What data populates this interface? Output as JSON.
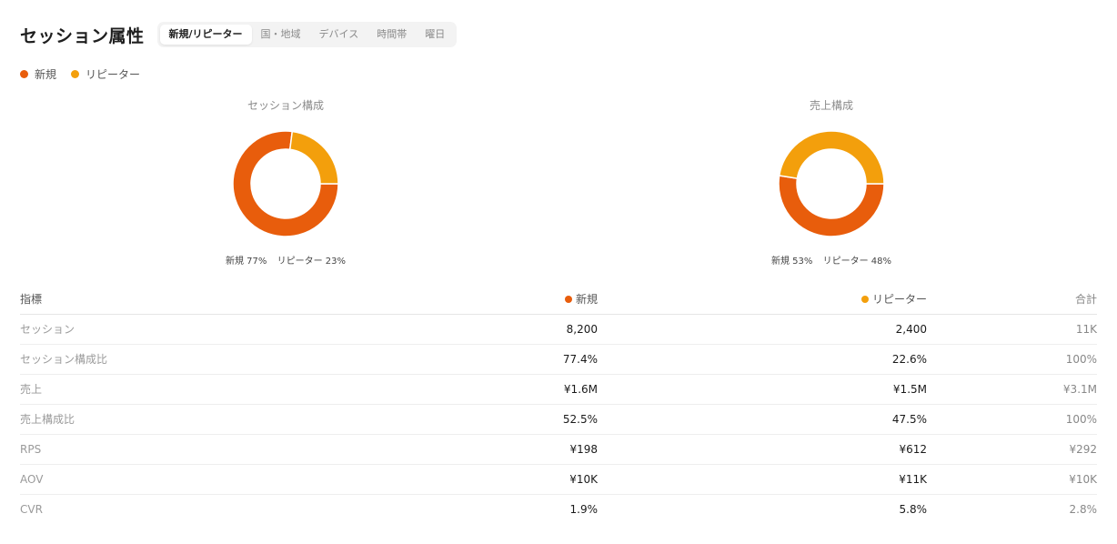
{
  "header": {
    "title": "セッション属性",
    "tabs": [
      "新規/リピーター",
      "国・地域",
      "デバイス",
      "時間帯",
      "曜日"
    ],
    "active_tab": "新規/リピーター"
  },
  "legend": [
    {
      "label": "新規",
      "color": "#e85d0c"
    },
    {
      "label": "リピーター",
      "color": "#f39f0c"
    }
  ],
  "colors": {
    "new": "#e85d0c",
    "repeat": "#f39f0c"
  },
  "chart_data": [
    {
      "type": "pie",
      "title": "セッション構成",
      "labels": [
        "新規",
        "リピーター"
      ],
      "values": [
        77,
        23
      ],
      "caption_new": "新規 77%",
      "caption_repeat": "リピーター 23%"
    },
    {
      "type": "pie",
      "title": "売上構成",
      "labels": [
        "新規",
        "リピーター"
      ],
      "values": [
        53,
        48
      ],
      "caption_new": "新規 53%",
      "caption_repeat": "リピーター 48%"
    }
  ],
  "table": {
    "headers": {
      "metric": "指標",
      "new": "新規",
      "repeat": "リピーター",
      "total": "合計"
    },
    "rows": [
      {
        "metric": "セッション",
        "new": "8,200",
        "repeat": "2,400",
        "total": "11K"
      },
      {
        "metric": "セッション構成比",
        "new": "77.4%",
        "repeat": "22.6%",
        "total": "100%"
      },
      {
        "metric": "売上",
        "new": "¥1.6M",
        "repeat": "¥1.5M",
        "total": "¥3.1M"
      },
      {
        "metric": "売上構成比",
        "new": "52.5%",
        "repeat": "47.5%",
        "total": "100%"
      },
      {
        "metric": "RPS",
        "new": "¥198",
        "repeat": "¥612",
        "total": "¥292"
      },
      {
        "metric": "AOV",
        "new": "¥10K",
        "repeat": "¥11K",
        "total": "¥10K"
      },
      {
        "metric": "CVR",
        "new": "1.9%",
        "repeat": "5.8%",
        "total": "2.8%"
      }
    ]
  }
}
